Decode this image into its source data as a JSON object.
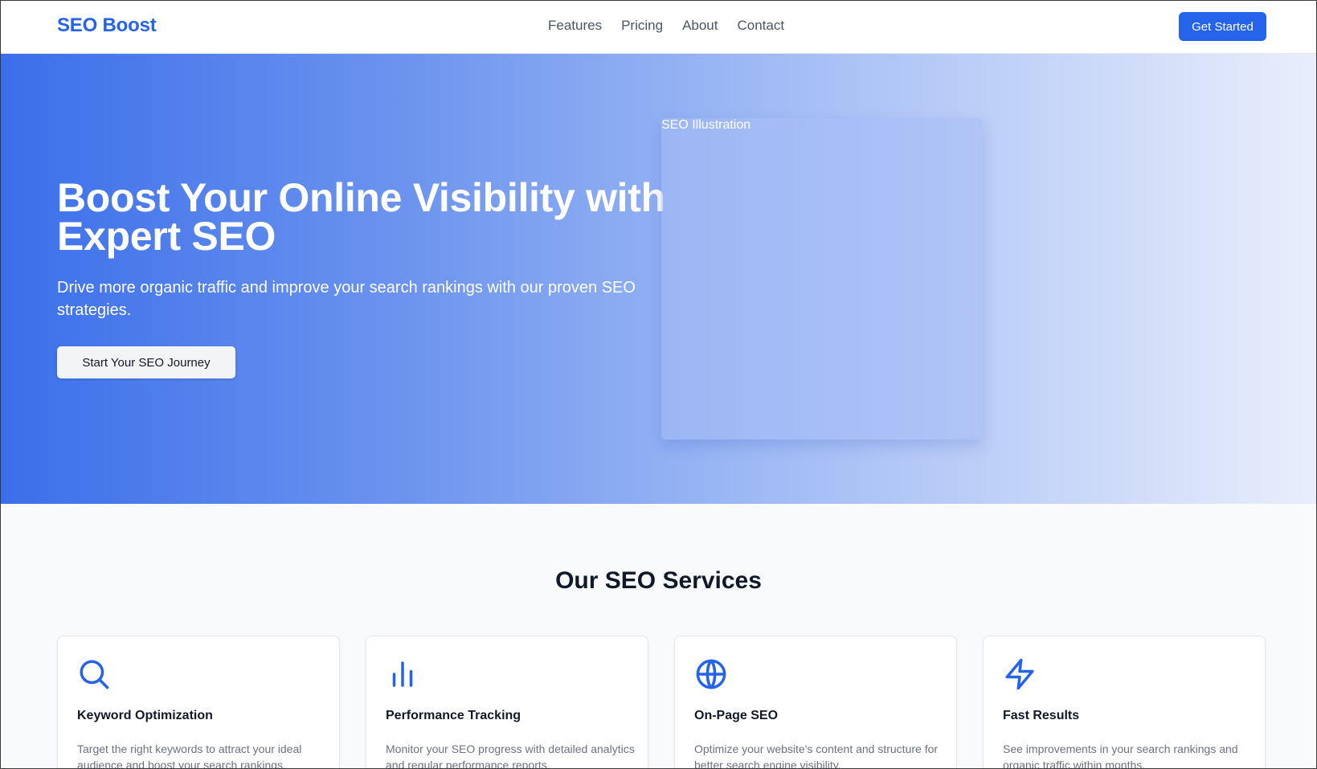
{
  "nav": {
    "brand": "SEO Boost",
    "links": [
      "Features",
      "Pricing",
      "About",
      "Contact"
    ],
    "cta": "Get Started"
  },
  "hero": {
    "title": "Boost Your Online Visibility with Expert SEO",
    "subtitle": "Drive more organic traffic and improve your search rankings with our proven SEO strategies.",
    "button": "Start Your SEO Journey",
    "illustration_label": "SEO Illustration"
  },
  "services": {
    "title": "Our SEO Services",
    "cards": [
      {
        "icon": "search-icon",
        "title": "Keyword Optimization",
        "description": "Target the right keywords to attract your ideal audience and boost your search rankings."
      },
      {
        "icon": "bar-chart-icon",
        "title": "Performance Tracking",
        "description": "Monitor your SEO progress with detailed analytics and regular performance reports."
      },
      {
        "icon": "globe-icon",
        "title": "On-Page SEO",
        "description": "Optimize your website's content and structure for better search engine visibility."
      },
      {
        "icon": "lightning-icon",
        "title": "Fast Results",
        "description": "See improvements in your search rankings and organic traffic within months."
      }
    ]
  },
  "colors": {
    "accent": "#2563eb",
    "text": "#111827",
    "muted": "#6b7280"
  }
}
